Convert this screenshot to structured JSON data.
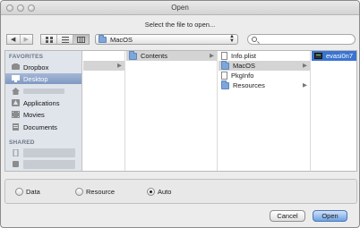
{
  "window": {
    "title": "Open"
  },
  "prompt": "Select the file to open...",
  "toolbar": {
    "back_icon": "chevron-left-icon",
    "forward_icon": "chevron-right-icon",
    "view_modes": [
      "icon-view-icon",
      "list-view-icon",
      "column-view-icon"
    ],
    "active_view": "column-view-icon",
    "location": "MacOS",
    "search_placeholder": ""
  },
  "sidebar": {
    "favorites_header": "FAVORITES",
    "favorites": [
      {
        "label": "Dropbox",
        "icon": "dropbox-icon",
        "selected": false
      },
      {
        "label": "Desktop",
        "icon": "desktop-icon",
        "selected": true
      },
      {
        "label": "",
        "icon": "home-icon",
        "selected": false
      },
      {
        "label": "Applications",
        "icon": "applications-icon",
        "selected": false
      },
      {
        "label": "Movies",
        "icon": "movies-icon",
        "selected": false
      },
      {
        "label": "Documents",
        "icon": "documents-icon",
        "selected": false
      }
    ],
    "shared_header": "SHARED",
    "shared": [
      {
        "label": "",
        "icon": "computer-icon"
      },
      {
        "label": "",
        "icon": "computer-icon"
      }
    ]
  },
  "columns": {
    "col1": [
      {
        "label": "",
        "selected": true
      }
    ],
    "col2": [
      {
        "label": "Contents",
        "icon": "folder-icon",
        "selected": true
      }
    ],
    "col3": [
      {
        "label": "Info.plist",
        "icon": "document-icon"
      },
      {
        "label": "MacOS",
        "icon": "folder-icon",
        "selected": true
      },
      {
        "label": "PkgInfo",
        "icon": "document-icon"
      },
      {
        "label": "Resources",
        "icon": "folder-icon"
      }
    ],
    "col4": [
      {
        "label": "evasi0n7",
        "icon": "executable-icon",
        "selected": true
      }
    ]
  },
  "options": {
    "radios": [
      {
        "label": "Data",
        "checked": false
      },
      {
        "label": "Resource",
        "checked": false
      },
      {
        "label": "Auto",
        "checked": true
      }
    ]
  },
  "buttons": {
    "cancel": "Cancel",
    "open": "Open"
  },
  "colors": {
    "selection": "#3a74d0",
    "sidebar": "#e0e5ec",
    "default_button": "#6fa2e3"
  }
}
